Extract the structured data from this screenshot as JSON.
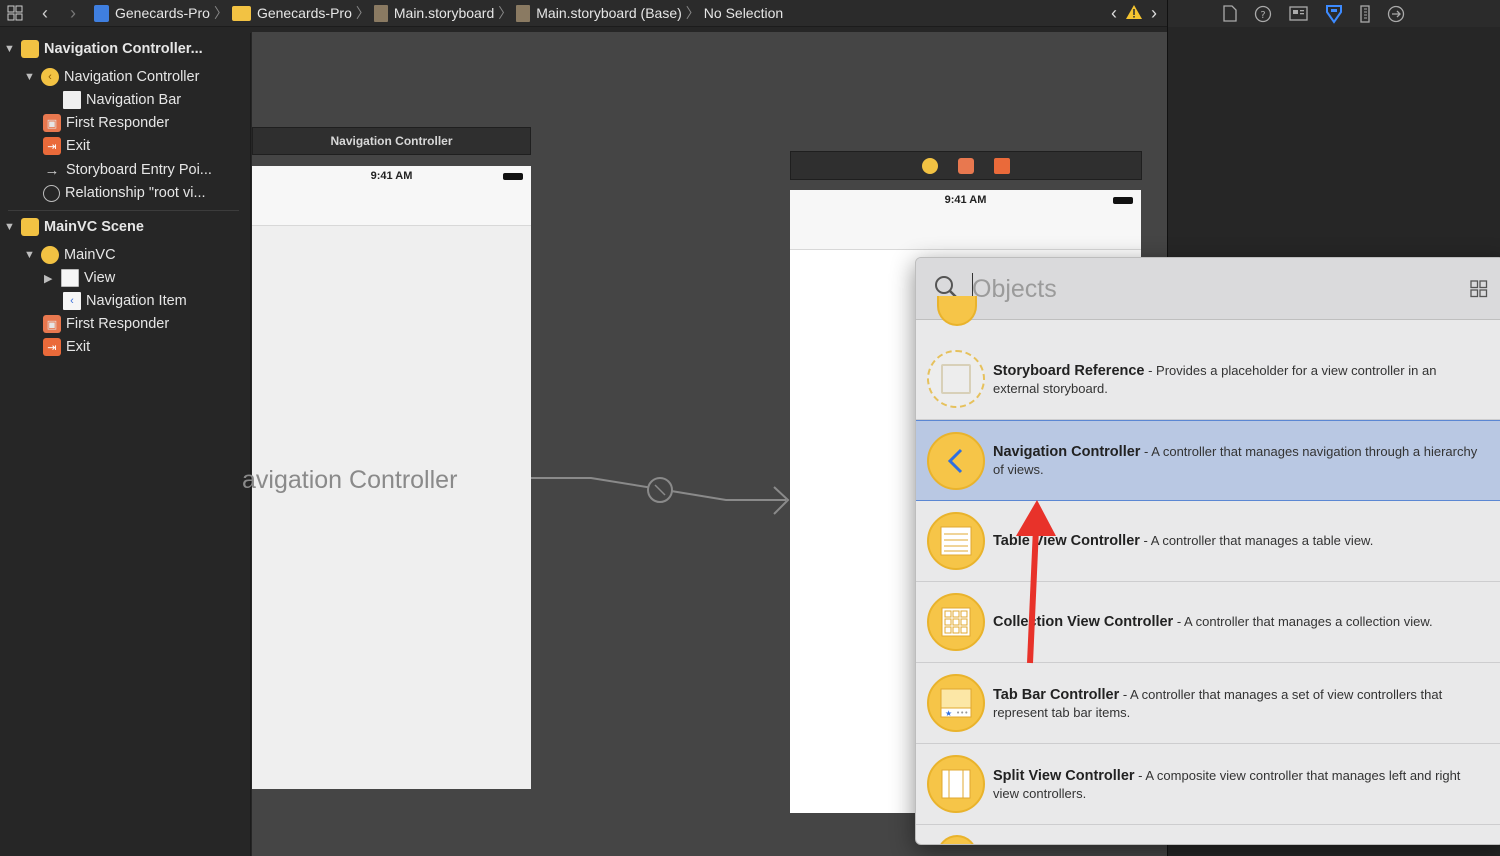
{
  "jumpbar": {
    "crumbs": [
      "Genecards-Pro",
      "Genecards-Pro",
      "Main.storyboard",
      "Main.storyboard (Base)",
      "No Selection"
    ]
  },
  "outline": {
    "scene1": {
      "label": "Navigation Controller...",
      "controller": "Navigation Controller",
      "nav_bar": "Navigation Bar",
      "first_responder": "First Responder",
      "exit": "Exit",
      "entry_point": "Storyboard Entry Poi...",
      "relationship": "Relationship \"root vi..."
    },
    "scene2": {
      "label": "MainVC Scene",
      "controller": "MainVC",
      "view": "View",
      "nav_item": "Navigation Item",
      "first_responder": "First Responder",
      "exit": "Exit"
    }
  },
  "canvas": {
    "scene1_title": "Navigation Controller",
    "time": "9:41 AM",
    "big_title": "avigation Controller",
    "scene2_time": "9:41 AM"
  },
  "library": {
    "search_placeholder": "Objects",
    "items": [
      {
        "name": "Storyboard Reference",
        "desc": " - Provides a placeholder for a view controller in an external storyboard.",
        "icon": "storyboard-reference-icon"
      },
      {
        "name": "Navigation Controller",
        "desc": " - A controller that manages navigation through a hierarchy of views.",
        "icon": "navigation-controller-icon",
        "selected": true
      },
      {
        "name": "Table View Controller",
        "desc": " - A controller that manages a table view.",
        "icon": "table-view-controller-icon"
      },
      {
        "name": "Collection View Controller",
        "desc": " - A controller that manages a collection view.",
        "icon": "collection-view-controller-icon"
      },
      {
        "name": "Tab Bar Controller",
        "desc": " - A controller that manages a set of view controllers that represent tab bar items.",
        "icon": "tab-bar-controller-icon"
      },
      {
        "name": "Split View Controller",
        "desc": " - A composite view controller that manages left and right view controllers.",
        "icon": "split-view-controller-icon"
      }
    ]
  },
  "colors": {
    "accent_yellow": "#f6c548",
    "selection": "#b9c8e3",
    "annotation_arrow": "#e8322a"
  }
}
